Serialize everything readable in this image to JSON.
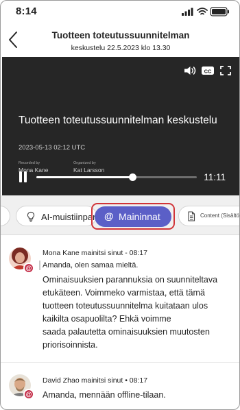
{
  "status": {
    "time": "8:14"
  },
  "header": {
    "title": "Tuotteen toteutussuunnitelman",
    "subtitle": "keskustelu 22.5.2023 klo 13.30"
  },
  "video": {
    "title": "Tuotteen toteutussuunnitelman keskustelu",
    "date": "2023-05-13 02:12 UTC",
    "recorded_by_label": "Recorded by",
    "recorded_by": "Mona Kane",
    "organized_by_label": "Organized by",
    "organized_by": "Kat Larsson",
    "duration": "11:11",
    "progress": 0.6
  },
  "tabs": {
    "ai_notes": "AI-muistiinpanot",
    "mentions": "Maininnat",
    "content": "Content (Sisältö)"
  },
  "feed": [
    {
      "author_line": "Mona Kane mainitsi sinut - 08:17",
      "quote": "Amanda, olen samaa mieltä.",
      "message_lines": [
        "Ominaisuuksien parannuksia on suunniteltava",
        "etukäteen. Voimmeko varmistaa, että tämä",
        "tuotteen toteutussuunnitelma kuitataan ulos",
        "kaikilta osapuolilta? Ehkä voimme",
        "saada palautetta ominaisuuksien muutosten",
        "priorisoinnista."
      ]
    },
    {
      "author_line": "David Zhao mainitsi sinut • 08:17",
      "message_lines": [
        "Amanda, mennään offline-tilaan."
      ]
    }
  ],
  "colors": {
    "accent": "#5b5fc7",
    "highlight": "#d13438",
    "mention_badge": "#c4314b",
    "video_bg": "#262626"
  },
  "icons": {
    "back": "chevron-left-icon",
    "volume": "volume-icon",
    "captions": "cc-icon",
    "fullscreen": "fullscreen-icon",
    "pause": "pause-icon",
    "ai_notes": "lightbulb-icon",
    "mentions": "at-icon",
    "content": "document-icon"
  }
}
